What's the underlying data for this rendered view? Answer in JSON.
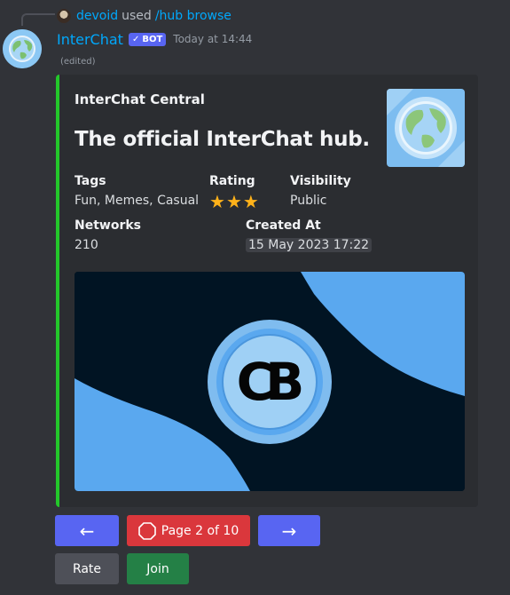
{
  "reply": {
    "user": "devoid",
    "used_text": "used",
    "command": "/hub browse"
  },
  "message": {
    "username": "InterChat",
    "bot_tag": "BOT",
    "timestamp": "Today at 14:44",
    "edited": "(edited)"
  },
  "embed": {
    "accent_color": "#23c72a",
    "provider": "InterChat Central",
    "title": "The official InterChat hub.",
    "fields": {
      "tags": {
        "name": "Tags",
        "value": "Fun, Memes, Casual"
      },
      "rating": {
        "name": "Rating",
        "stars": 3
      },
      "visibility": {
        "name": "Visibility",
        "value": "Public"
      },
      "networks": {
        "name": "Networks",
        "value": "210"
      },
      "created_at": {
        "name": "Created At",
        "value": "15 May 2023 17:22"
      }
    },
    "thumbnail_icon": "globe-icon",
    "image_text": "CB"
  },
  "buttons": {
    "prev_icon": "left-arrow-icon",
    "page_label": "Page 2 of 10",
    "page_icon": "stop-sign-icon",
    "next_icon": "right-arrow-icon",
    "rate_label": "Rate",
    "join_label": "Join"
  }
}
